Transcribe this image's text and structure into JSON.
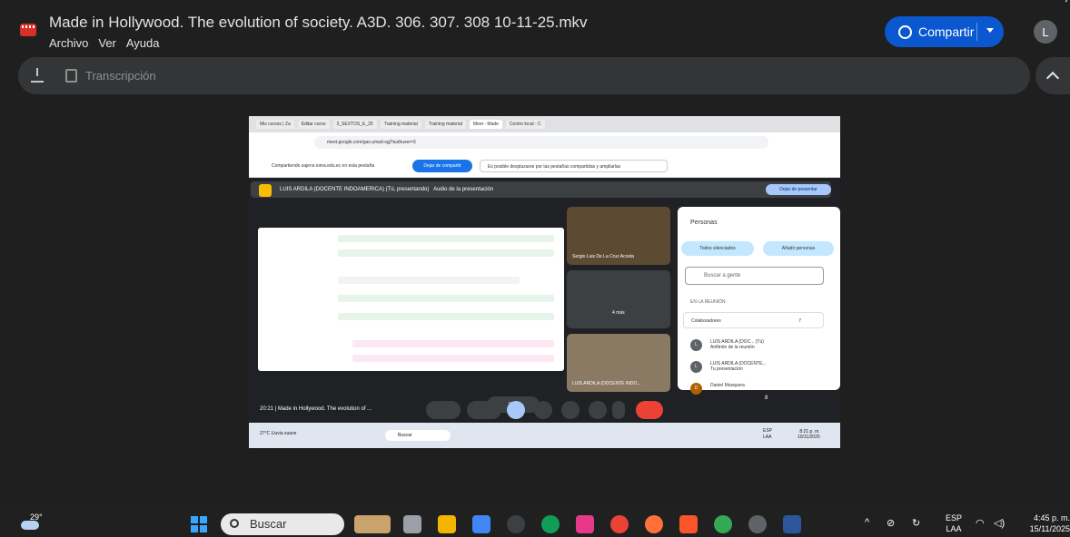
{
  "window": {
    "title": "Made in Hollywood.  The evolution of society. A3D. 306. 307. 308 10-11-25.mkv",
    "menu": [
      "Archivo",
      "Ver",
      "Ayuda"
    ],
    "share_label": "Compartir",
    "avatar_letter": "L"
  },
  "toolbar": {
    "transcript_label": "Transcripción"
  },
  "video": {
    "tabs": [
      "Mis cursos | Za",
      "Editar curso",
      "3_SEXTOS_E_25",
      "Training material",
      "Training material",
      "Meet - Made",
      "Centro local - C"
    ],
    "url": "meet.google.com/gas-ymad-sgj?authuser=3",
    "share_bar": {
      "sharing_text": "Compartiendo  sajeno.ioma.edu.ec  en esta pestaña",
      "stop_label": "Dejar de compartir",
      "note": "Es posible desplazarse por las pestañas compartidas y ampliarlas"
    },
    "meet_header": {
      "presenter": "LUIS ARDILA (DOCENTE INDOAMERICA) (Tú, presentando)",
      "audio_label": "Audio de la presentación",
      "stop_present": "Dejar de presentar"
    },
    "zoom": "90%",
    "tiles": [
      {
        "name": "Sergio Luis De La Cruz Acosta"
      },
      {
        "name": "4 más"
      },
      {
        "name": "LUIS ARDILA (DOCENTE INDO..."
      }
    ],
    "people": {
      "title": "Personas",
      "mute_all": "Todos silenciados",
      "add_people": "Añadir personas",
      "search_placeholder": "Buscar a gente",
      "section": "EN LA REUNIÓN",
      "collaborators": "Colaboradores",
      "collab_count": "7",
      "members": [
        {
          "initial": "L",
          "name": "LUIS ARDILA (DOC...  (Tú)",
          "sub": "Anfitrión de la reunión"
        },
        {
          "initial": "L",
          "name": "LUIS ARDILA (DOCENTE...",
          "sub": "Tu presentación"
        },
        {
          "initial": "D",
          "name": "Daniel Mosquera",
          "sub": ""
        }
      ]
    },
    "controls": {
      "time_title": "20:21  |  Made in Hollywood. The evolution of ...",
      "participants_badge": "8"
    },
    "inner_taskbar": {
      "weather": "27°C",
      "weather_desc": "Lluvia suave",
      "search": "Buscar",
      "lang": "ESP",
      "lang2": "LAA",
      "time": "8:21 p. m.",
      "date": "10/11/2025"
    }
  },
  "taskbar": {
    "temp": "29°",
    "search": "Buscar",
    "lang": "ESP",
    "lang2": "LAA",
    "time": "4:45 p. m.",
    "date": "15/11/2025"
  }
}
